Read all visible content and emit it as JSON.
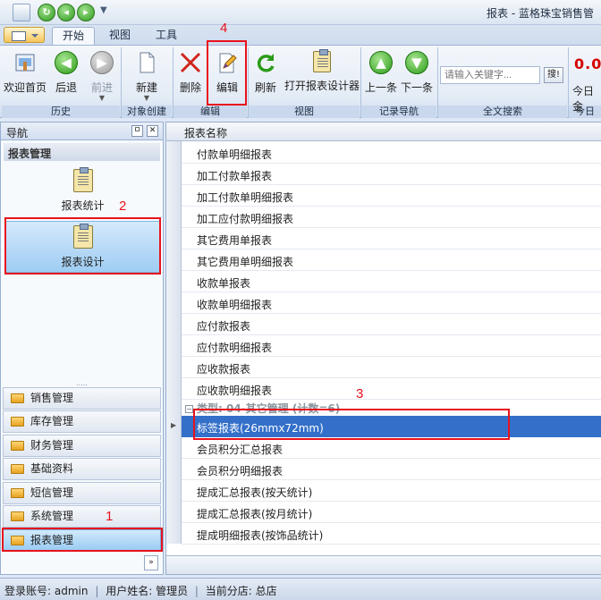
{
  "window": {
    "title": "报表 - 蓝格珠宝销售管"
  },
  "tabs": [
    {
      "label": "开始"
    },
    {
      "label": "视图"
    },
    {
      "label": "工具"
    }
  ],
  "ribbon": {
    "groups": [
      {
        "label": "历史"
      },
      {
        "label": "对象创建"
      },
      {
        "label": "编辑"
      },
      {
        "label": "视图"
      },
      {
        "label": "记录导航"
      },
      {
        "label": "全文搜索"
      },
      {
        "label": "今日"
      }
    ],
    "buttons": {
      "home": "欢迎首页",
      "back": "后退",
      "forward": "前进",
      "new": "新建",
      "delete": "删除",
      "edit": "编辑",
      "refresh": "刷新",
      "open_designer": "打开报表设计器",
      "prev": "上一条",
      "next": "下一条"
    },
    "search": {
      "placeholder": "请输入关键字...",
      "button": "搜!"
    },
    "today": {
      "value": "0.0",
      "label": "今日金"
    }
  },
  "nav": {
    "title": "导航",
    "pin": "ㅁ",
    "close": "✕",
    "section": "报表管理",
    "items": [
      {
        "label": "报表统计"
      },
      {
        "label": "报表设计"
      }
    ],
    "categories": [
      {
        "label": "销售管理"
      },
      {
        "label": "库存管理"
      },
      {
        "label": "财务管理"
      },
      {
        "label": "基础资料"
      },
      {
        "label": "短信管理"
      },
      {
        "label": "系统管理"
      },
      {
        "label": "报表管理"
      }
    ],
    "more": "»"
  },
  "grid": {
    "header": "报表名称",
    "rows_top": [
      "付款单明细报表",
      "加工付款单报表",
      "加工付款单明细报表",
      "加工应付款明细报表",
      "其它费用单报表",
      "其它费用单明细报表",
      "收款单报表",
      "收款单明细报表",
      "应付款报表",
      "应付款明细报表",
      "应收款报表",
      "应收款明细报表"
    ],
    "group": "类型: 04-其它管理 (计数=6)",
    "rows_bottom": [
      "标签报表(26mmx72mm)",
      "会员积分汇总报表",
      "会员积分明细报表",
      "提成汇总报表(按天统计)",
      "提成汇总报表(按月统计)",
      "提成明细报表(按饰品统计)"
    ]
  },
  "status": {
    "account_label": "登录账号:",
    "account": "admin",
    "name_label": "用户姓名:",
    "name": "管理员",
    "branch_label": "当前分店:",
    "branch": "总店"
  },
  "annotations": [
    "1",
    "2",
    "3",
    "4"
  ],
  "colors": {
    "selection": "#3470c9",
    "annotation": "#e8121c",
    "accent": "#98afd0"
  }
}
